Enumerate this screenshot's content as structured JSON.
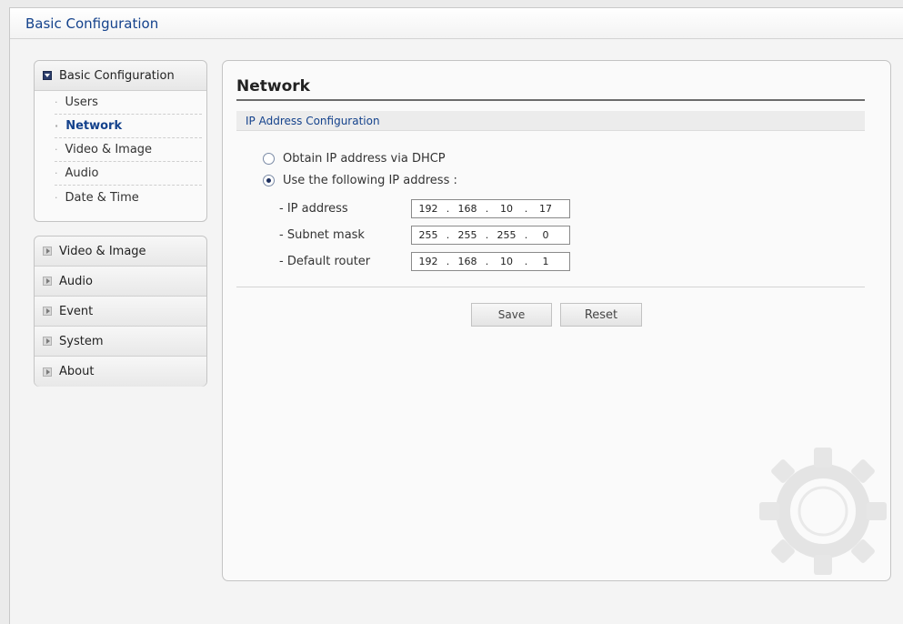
{
  "header": {
    "title": "Basic Configuration"
  },
  "sidebar": {
    "open_section": {
      "label": "Basic Configuration",
      "items": [
        {
          "label": "Users"
        },
        {
          "label": "Network",
          "active": true
        },
        {
          "label": "Video & Image"
        },
        {
          "label": "Audio"
        },
        {
          "label": "Date & Time"
        }
      ]
    },
    "sections": [
      {
        "label": "Video & Image"
      },
      {
        "label": "Audio"
      },
      {
        "label": "Event"
      },
      {
        "label": "System"
      },
      {
        "label": "About"
      }
    ]
  },
  "main": {
    "title": "Network",
    "section_title": "IP Address Configuration",
    "radio_dhcp": {
      "label": "Obtain IP address via DHCP",
      "checked": false
    },
    "radio_static": {
      "label": "Use the following IP address :",
      "checked": true
    },
    "ip_address": {
      "label": "- IP address",
      "octets": [
        "192",
        "168",
        "10",
        "17"
      ]
    },
    "subnet_mask": {
      "label": "- Subnet mask",
      "octets": [
        "255",
        "255",
        "255",
        "0"
      ]
    },
    "default_router": {
      "label": "- Default router",
      "octets": [
        "192",
        "168",
        "10",
        "1"
      ]
    },
    "buttons": {
      "save": "Save",
      "reset": "Reset"
    },
    "octet_separator": "."
  },
  "colors": {
    "accent": "#14428c",
    "background": "#ebebeb",
    "panel": "#fafafa",
    "border": "#c4c4c4"
  }
}
